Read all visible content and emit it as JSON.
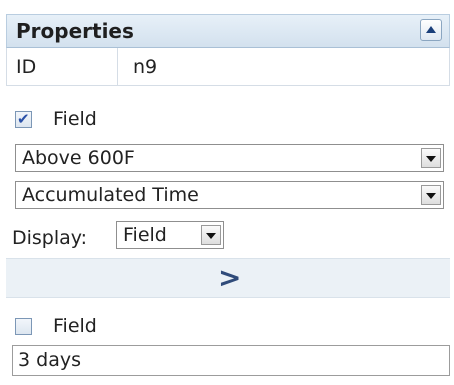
{
  "header": {
    "title": "Properties"
  },
  "id_row": {
    "label": "ID",
    "value": "n9"
  },
  "field_check_1": {
    "label": "Field",
    "checked": true
  },
  "select_1": {
    "value": "Above 600F"
  },
  "select_2": {
    "value": "Accumulated Time"
  },
  "display": {
    "label": "Display:",
    "value": "Field"
  },
  "next_bar": {
    "label": ">"
  },
  "field_check_2": {
    "label": "Field",
    "checked": false
  },
  "text_input": {
    "value": "3 days"
  }
}
